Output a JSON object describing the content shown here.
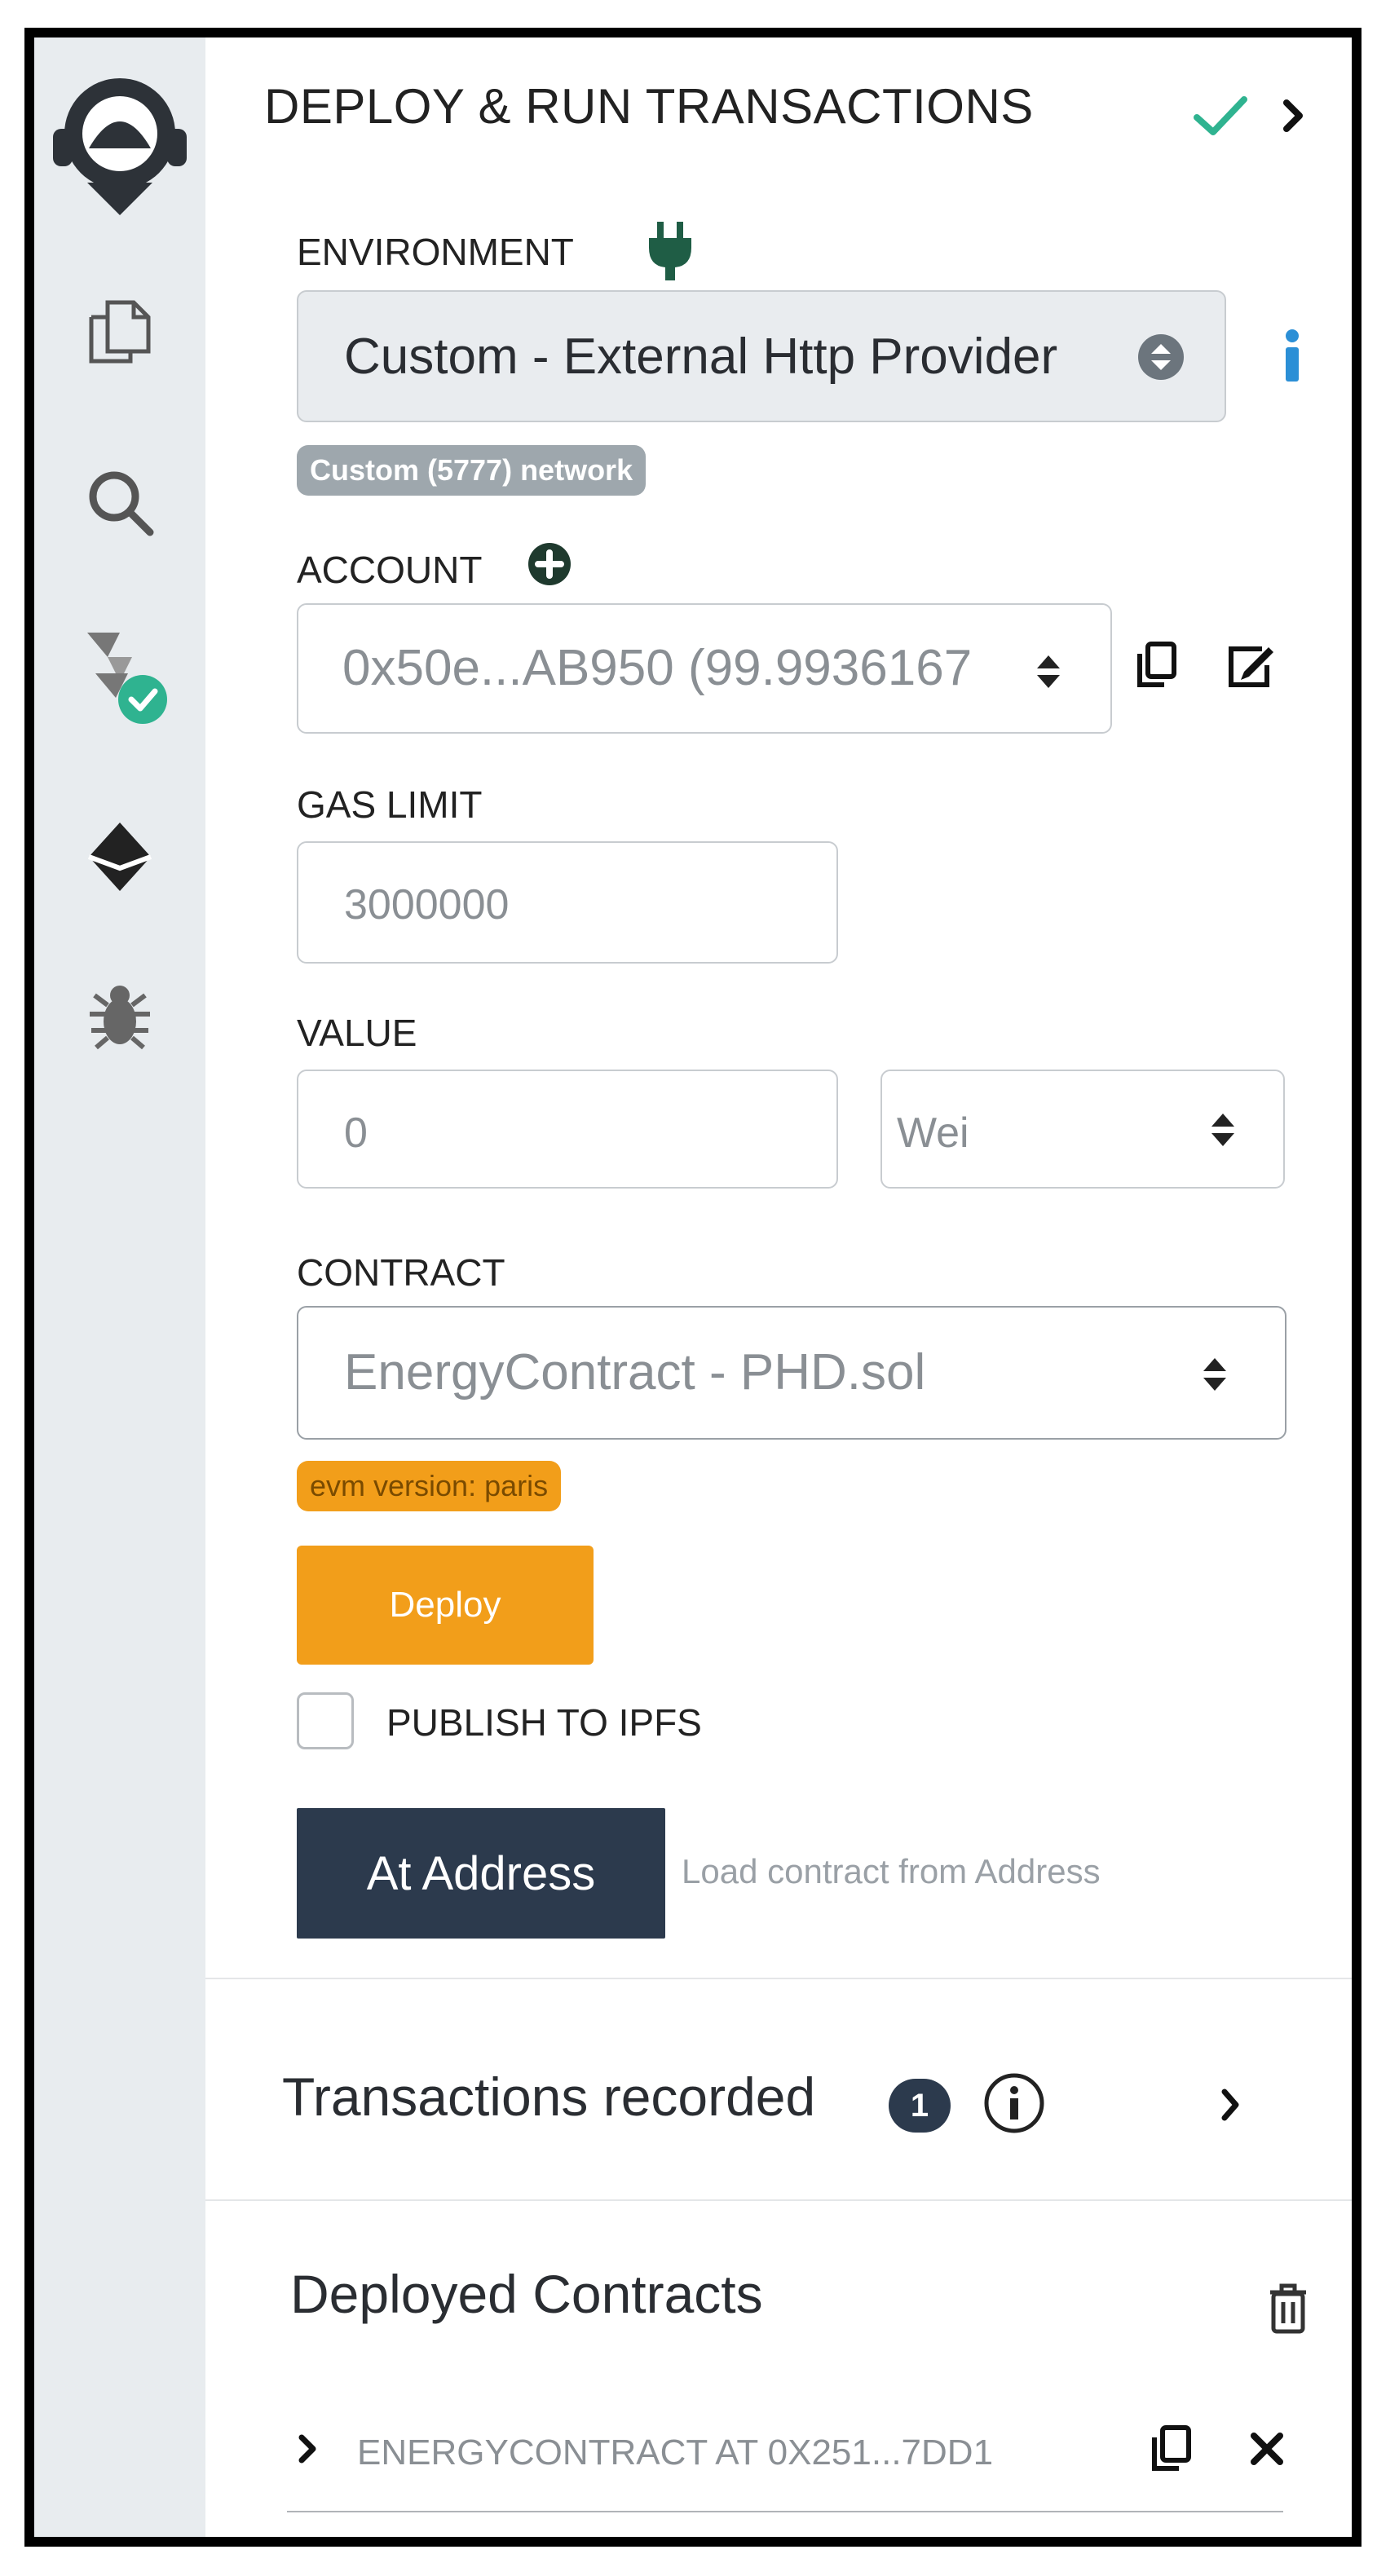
{
  "header": {
    "title": "DEPLOY & RUN TRANSACTIONS"
  },
  "environment": {
    "label": "ENVIRONMENT",
    "value": "Custom - External Http Provider",
    "network_badge": "Custom (5777) network"
  },
  "account": {
    "label": "ACCOUNT",
    "value": "0x50e...AB950 (99.9936167"
  },
  "gas_limit": {
    "label": "GAS LIMIT",
    "value": "3000000"
  },
  "value": {
    "label": "VALUE",
    "amount": "0",
    "unit": "Wei"
  },
  "contract": {
    "label": "CONTRACT",
    "value": "EnergyContract - PHD.sol",
    "evm_badge": "evm version: paris"
  },
  "deploy": {
    "label": "Deploy"
  },
  "publish": {
    "label": "PUBLISH TO IPFS"
  },
  "at_address": {
    "label": "At Address",
    "placeholder": "Load contract from Address"
  },
  "transactions": {
    "label": "Transactions recorded",
    "count": "1"
  },
  "deployed": {
    "label": "Deployed Contracts",
    "items": [
      {
        "label": "ENERGYCONTRACT AT 0X251...7DD1"
      }
    ]
  },
  "colors": {
    "accent": "#2fb390",
    "orange": "#f29e1a",
    "dark": "#2c3a4d",
    "sidebar": "#e8ecef"
  }
}
